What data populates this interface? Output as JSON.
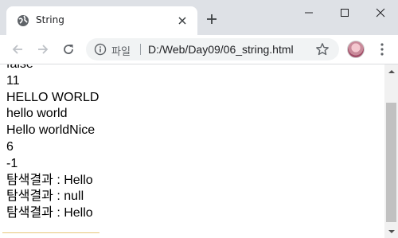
{
  "tab": {
    "title": "String"
  },
  "omnibox": {
    "security_label": "파일",
    "url": "D:/Web/Day09/06_string.html"
  },
  "content": {
    "lines": [
      "false",
      "11",
      "HELLO WORLD",
      "hello world",
      "Hello worldNice",
      "6",
      "-1",
      "탐색결과 : Hello",
      "탐색결과 : null",
      "탐색결과 : Hello"
    ]
  },
  "icons": {
    "favicon": "globe-icon",
    "tab_close": "close-icon",
    "new_tab": "plus-icon",
    "back": "arrow-left-icon",
    "forward": "arrow-right-icon",
    "reload": "reload-icon",
    "info": "info-icon",
    "bookmark": "star-icon",
    "menu": "kebab-menu-icon"
  },
  "colors": {
    "titlebar": "#dee1e6",
    "omnibox": "#f1f3f4",
    "scroll_thumb": "#c1c1c1"
  }
}
